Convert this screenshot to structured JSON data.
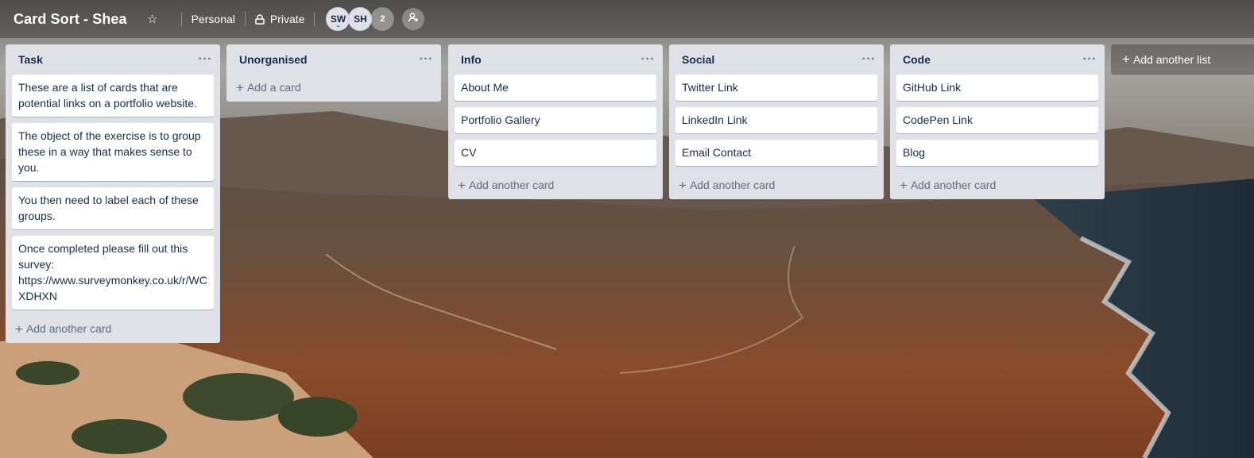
{
  "header": {
    "title": "Card Sort - Shea",
    "star_icon": "star-icon",
    "team_label": "Personal",
    "visibility_label": "Private",
    "members": [
      {
        "initials": "SW",
        "is_admin": true
      },
      {
        "initials": "SH",
        "is_admin": false
      }
    ],
    "member_overflow": "2",
    "invite_icon": "add-member-icon"
  },
  "lists": [
    {
      "title": "Task",
      "cards": [
        "These are a list of cards that are potential links on a portfolio website.",
        "The object of the exercise is to group these in a way that makes sense to you.",
        "You then need to label each of these groups.",
        "Once completed please fill out this survey: https://www.surveymonkey.co.uk/r/WCXDHXN"
      ],
      "add_label": "Add another card"
    },
    {
      "title": "Unorganised",
      "cards": [],
      "add_label": "Add a card"
    },
    {
      "title": "Info",
      "cards": [
        "About Me",
        "Portfolio Gallery",
        "CV"
      ],
      "add_label": "Add another card"
    },
    {
      "title": "Social",
      "cards": [
        "Twitter Link",
        "LinkedIn Link",
        "Email Contact"
      ],
      "add_label": "Add another card"
    },
    {
      "title": "Code",
      "cards": [
        "GitHub Link",
        "CodePen Link",
        "Blog"
      ],
      "add_label": "Add another card"
    }
  ],
  "add_list_label": "Add another list",
  "list_menu_glyph": "···",
  "colors": {
    "list_bg": "#dfe1e6",
    "card_text": "#172b4d",
    "muted_text": "#5e6c84"
  }
}
